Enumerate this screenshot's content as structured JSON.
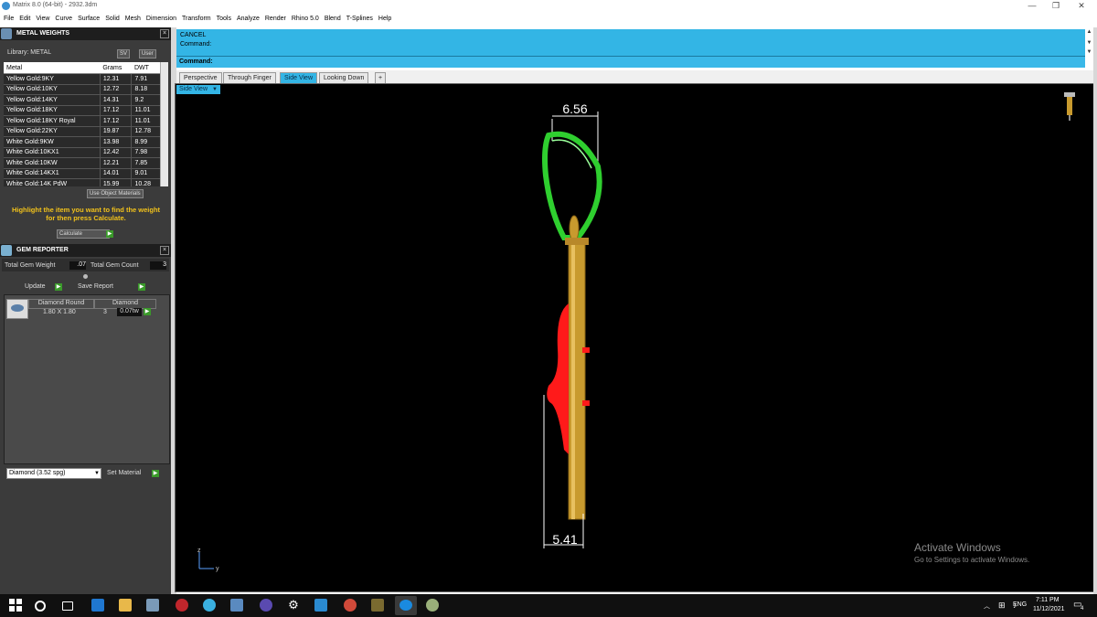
{
  "window": {
    "title": "Matrix 8.0 (64-bit) - 2932.3dm",
    "controls": [
      "—",
      "❐",
      "✕"
    ]
  },
  "menu": [
    "File",
    "Edit",
    "View",
    "Curve",
    "Surface",
    "Solid",
    "Mesh",
    "Dimension",
    "Transform",
    "Tools",
    "Analyze",
    "Render",
    "Rhino 5.0",
    "Blend",
    "T-Splines",
    "Help"
  ],
  "metal_weights": {
    "title": "METAL WEIGHTS",
    "library_label": "Library: METAL",
    "sv_btn": "SV",
    "user_btn": "User",
    "columns": [
      "Metal",
      "Grams",
      "DWT"
    ],
    "rows": [
      [
        "Yellow Gold:9KY",
        "12.31",
        "7.91"
      ],
      [
        "Yellow Gold:10KY",
        "12.72",
        "8.18"
      ],
      [
        "Yellow Gold:14KY",
        "14.31",
        "9.2"
      ],
      [
        "Yellow Gold:18KY",
        "17.12",
        "11.01"
      ],
      [
        "Yellow Gold:18KY Royal",
        "17.12",
        "11.01"
      ],
      [
        "Yellow Gold:22KY",
        "19.87",
        "12.78"
      ],
      [
        "White Gold:9KW",
        "13.98",
        "8.99"
      ],
      [
        "White Gold:10KX1",
        "12.42",
        "7.98"
      ],
      [
        "White Gold:10KW",
        "12.21",
        "7.85"
      ],
      [
        "White Gold:14KX1",
        "14.01",
        "9.01"
      ],
      [
        "White Gold:14K PdW",
        "15.99",
        "10.28"
      ]
    ],
    "use_object_materials": "Use Object Materials",
    "hint": "Highlight the item you want to find the weight for then press Calculate.",
    "calculate_btn": "Calculate"
  },
  "gem_reporter": {
    "title": "GEM REPORTER",
    "total_weight_label": "Total Gem Weight",
    "total_weight_value": ".07",
    "total_count_label": "Total Gem Count",
    "total_count_value": "3",
    "update_btn": "Update",
    "save_report_btn": "Save Report",
    "gem_headers": [
      "Diamond Round",
      "Diamond"
    ],
    "gem_size": "1.80 X 1.80",
    "gem_count": "3",
    "gem_weight": "0.07tw",
    "material_select": "Diamond     (3.52 spg)",
    "set_material_btn": "Set Material"
  },
  "command": {
    "line1": "CANCEL",
    "line2": "Command:",
    "prompt": "Command:"
  },
  "tabs": [
    "Perspective",
    "Through Finger",
    "Side View",
    "Looking Down"
  ],
  "active_tab": "Side View",
  "viewport": {
    "label": "Side View",
    "dim_top": "6.56",
    "dim_bottom": "5.41",
    "axis_z": "z",
    "axis_y": "y",
    "activate_title": "Activate Windows",
    "activate_sub": "Go to Settings to activate Windows."
  },
  "taskbar": {
    "lang": "ENG",
    "time": "7:11 PM",
    "date": "11/12/2021",
    "notifications": "4"
  },
  "colors": {
    "accent": "#33b5e5",
    "panel_bg": "#3b3b3b",
    "hint_text": "#f2c21b",
    "bail": "#2fcf2f",
    "gems": "#ff1a1a",
    "gold": "#c89a2e"
  }
}
